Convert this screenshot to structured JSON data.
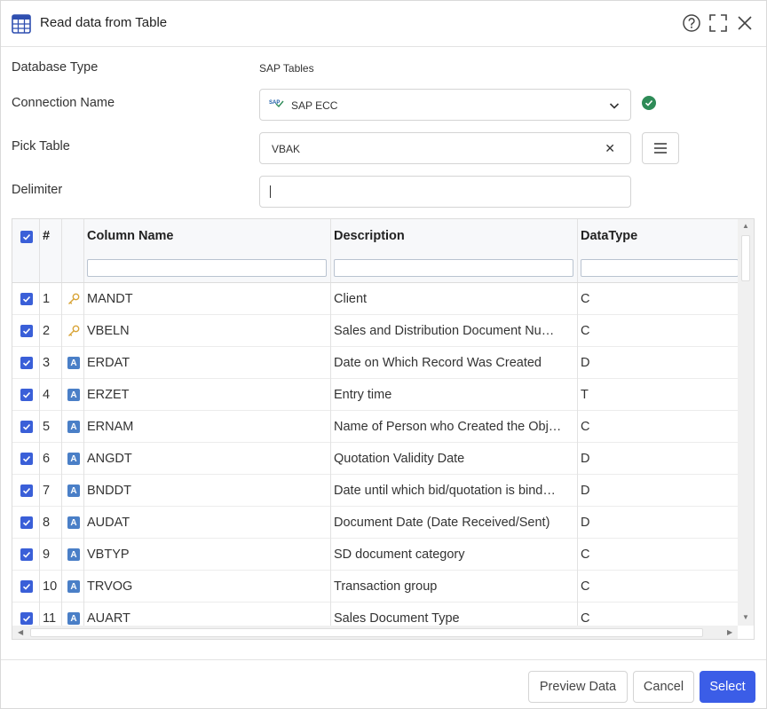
{
  "window": {
    "title": "Read data from Table"
  },
  "form": {
    "database_type_label": "Database Type",
    "database_type_value": "SAP Tables",
    "connection_label": "Connection Name",
    "connection_logo": "SAP",
    "connection_value": "SAP ECC",
    "pick_table_label": "Pick Table",
    "pick_table_value": "VBAK",
    "delimiter_label": "Delimiter",
    "delimiter_value": ""
  },
  "grid": {
    "headers": {
      "num": "#",
      "column_name": "Column Name",
      "description": "Description",
      "datatype": "DataType"
    },
    "rows": [
      {
        "n": "1",
        "icon": "key-icon",
        "name": "MANDT",
        "desc": "Client",
        "type": "C"
      },
      {
        "n": "2",
        "icon": "key-icon",
        "name": "VBELN",
        "desc": "Sales and Distribution Document Nu…",
        "type": "C"
      },
      {
        "n": "3",
        "icon": "A",
        "name": "ERDAT",
        "desc": "Date on Which Record Was Created",
        "type": "D"
      },
      {
        "n": "4",
        "icon": "A",
        "name": "ERZET",
        "desc": "Entry time",
        "type": "T"
      },
      {
        "n": "5",
        "icon": "A",
        "name": "ERNAM",
        "desc": "Name of Person who Created the Obj…",
        "type": "C"
      },
      {
        "n": "6",
        "icon": "A",
        "name": "ANGDT",
        "desc": "Quotation Validity Date",
        "type": "D"
      },
      {
        "n": "7",
        "icon": "A",
        "name": "BNDDT",
        "desc": "Date until which bid/quotation is bind…",
        "type": "D"
      },
      {
        "n": "8",
        "icon": "A",
        "name": "AUDAT",
        "desc": "Document Date (Date Received/Sent)",
        "type": "D"
      },
      {
        "n": "9",
        "icon": "A",
        "name": "VBTYP",
        "desc": "SD document category",
        "type": "C"
      },
      {
        "n": "10",
        "icon": "A",
        "name": "TRVOG",
        "desc": "Transaction group",
        "type": "C"
      },
      {
        "n": "11",
        "icon": "A",
        "name": "AUART",
        "desc": "Sales Document Type",
        "type": "C"
      }
    ]
  },
  "footer": {
    "preview_label": "Preview Data",
    "cancel_label": "Cancel",
    "select_label": "Select"
  },
  "colors": {
    "accent": "#3b5de7",
    "checkbox": "#3a5fd8",
    "ok": "#2e8b57",
    "type_badge": "#4a7fc7"
  }
}
